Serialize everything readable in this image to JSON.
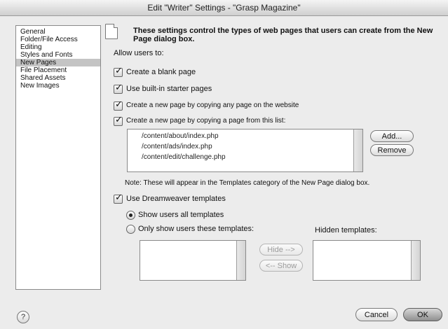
{
  "window": {
    "title": "Edit \"Writer\" Settings - \"Grasp Magazine\""
  },
  "sidebar": {
    "items": [
      {
        "label": "General"
      },
      {
        "label": "Folder/File Access"
      },
      {
        "label": "Editing"
      },
      {
        "label": "Styles and Fonts"
      },
      {
        "label": "New Pages",
        "selected": true
      },
      {
        "label": "File Placement"
      },
      {
        "label": "Shared Assets"
      },
      {
        "label": "New Images"
      }
    ]
  },
  "main": {
    "intro": "These settings control the types of web pages that users can create from the New Page dialog box.",
    "allow_label": "Allow users to:",
    "options": {
      "blank_page": {
        "label": "Create a blank page",
        "checked": true
      },
      "starter_pages": {
        "label": "Use built-in starter pages",
        "checked": true
      },
      "copy_any": {
        "label": "Create a new page by copying any page on the website",
        "checked": true
      },
      "copy_list": {
        "label": "Create a new page by copying a page from this list:",
        "checked": true
      }
    },
    "page_list": [
      "/content/about/index.php",
      "/content/ads/index.php",
      "/content/edit/challenge.php"
    ],
    "add_button": "Add...",
    "remove_button": "Remove",
    "note": "Note: These will appear in the Templates category of the New Page dialog box.",
    "dw_templates": {
      "label": "Use Dreamweaver templates",
      "checked": true
    },
    "radio_all": {
      "label": "Show users all templates",
      "selected": true
    },
    "radio_these": {
      "label": "Only show users these templates:",
      "selected": false
    },
    "hidden_templates_label": "Hidden templates:",
    "hide_button": "Hide -->",
    "show_button": "<-- Show"
  },
  "footer": {
    "help": "?",
    "cancel": "Cancel",
    "ok": "OK"
  }
}
